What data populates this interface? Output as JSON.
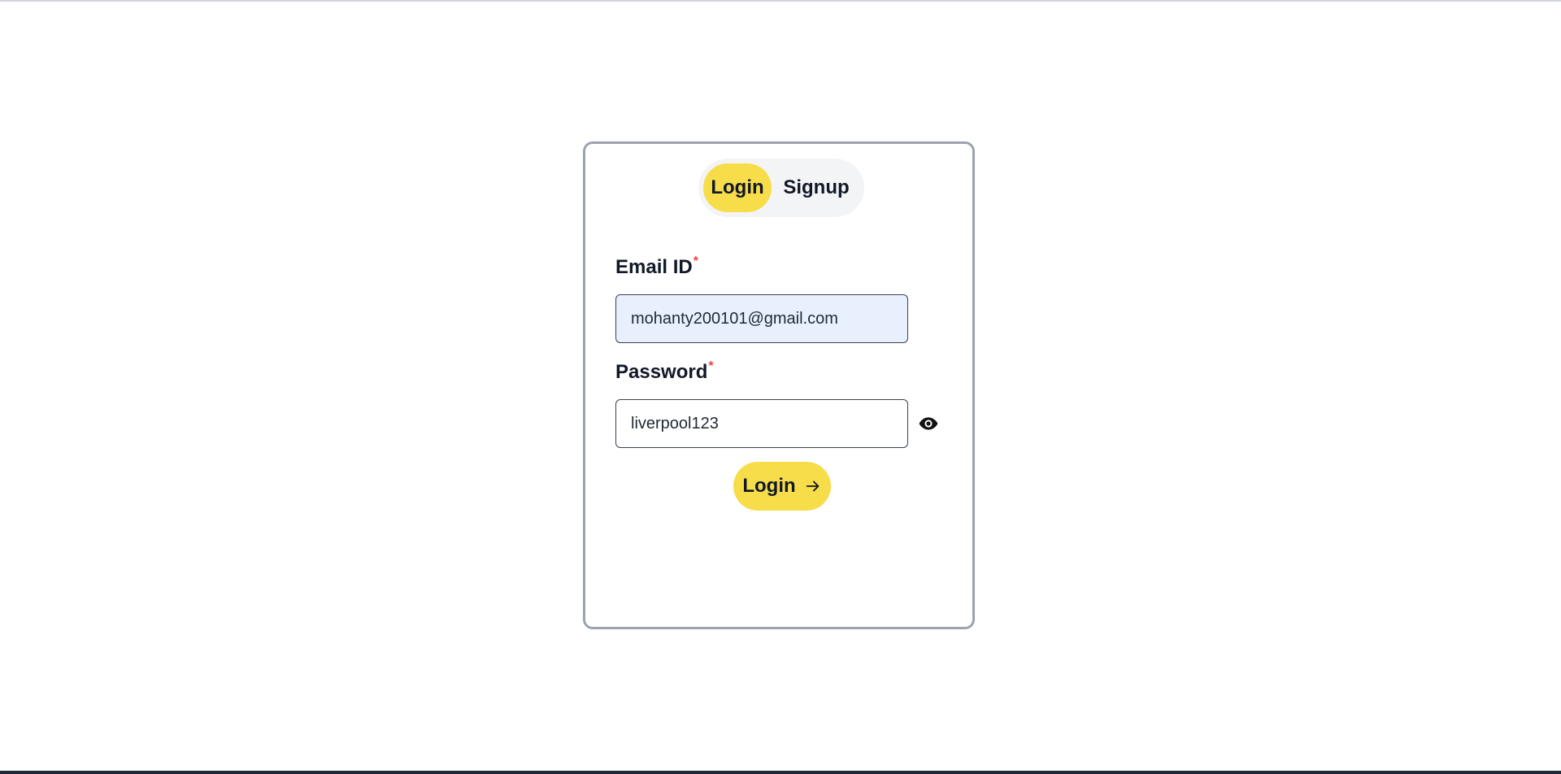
{
  "tabs": {
    "login_label": "Login",
    "signup_label": "Signup",
    "active": "login"
  },
  "form": {
    "email_label": "Email ID",
    "email_required_mark": "*",
    "email_value": "mohanty200101@gmail.com",
    "password_label": "Password",
    "password_required_mark": "*",
    "password_value": "liverpool123",
    "password_visibility_icon": "eye-icon",
    "submit_label": "Login",
    "submit_icon": "arrow-right-icon"
  },
  "colors": {
    "accent": "#f7dd4a",
    "autofill_bg": "#e8f0fe",
    "required": "#ef4444",
    "card_border": "#9ca3af"
  }
}
